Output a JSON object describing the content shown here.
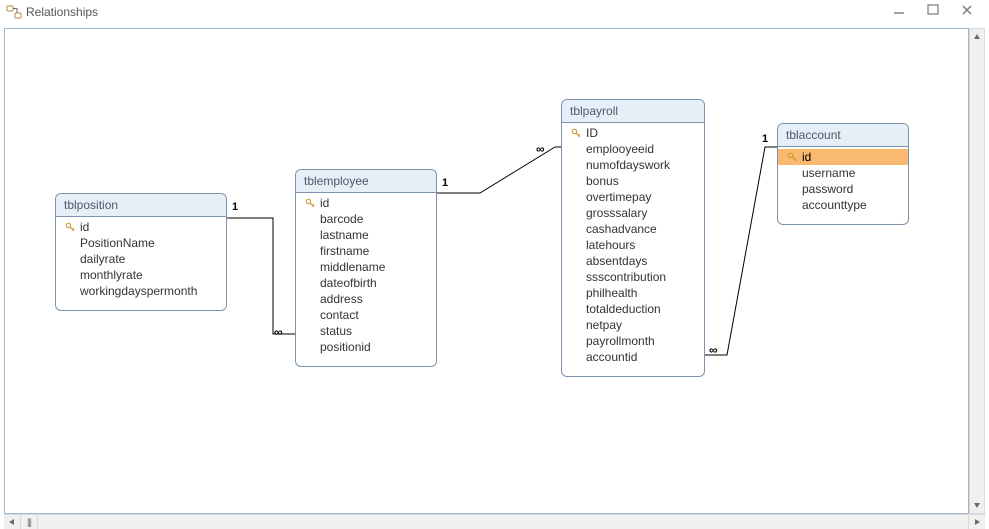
{
  "window": {
    "title": "Relationships"
  },
  "tables": {
    "tblposition": {
      "name": "tblposition",
      "fields": [
        "id",
        "PositionName",
        "dailyrate",
        "monthlyrate",
        "workingdayspermonth"
      ],
      "pk": "id"
    },
    "tblemployee": {
      "name": "tblemployee",
      "fields": [
        "id",
        "barcode",
        "lastname",
        "firstname",
        "middlename",
        "dateofbirth",
        "address",
        "contact",
        "status",
        "positionid"
      ],
      "pk": "id"
    },
    "tblpayroll": {
      "name": "tblpayroll",
      "fields": [
        "ID",
        "emplooyeeid",
        "numofdayswork",
        "bonus",
        "overtimepay",
        "grosssalary",
        "cashadvance",
        "latehours",
        "absentdays",
        "ssscontribution",
        "philhealth",
        "totaldeduction",
        "netpay",
        "payrollmonth",
        "accountid"
      ],
      "pk": "ID"
    },
    "tblaccount": {
      "name": "tblaccount",
      "fields": [
        "id",
        "username",
        "password",
        "accounttype"
      ],
      "pk": "id",
      "selected": "id"
    }
  },
  "cardinality": {
    "one": "1",
    "many": "∞"
  }
}
